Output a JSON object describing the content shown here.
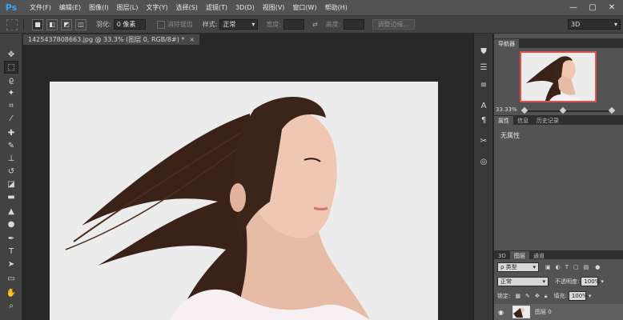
{
  "app": {
    "logo": "Ps"
  },
  "menu": [
    "文件(F)",
    "编辑(E)",
    "图像(I)",
    "图层(L)",
    "文字(Y)",
    "选择(S)",
    "滤镜(T)",
    "3D(D)",
    "视图(V)",
    "窗口(W)",
    "帮助(H)"
  ],
  "window_controls": {
    "minimize": "—",
    "maximize": "▢",
    "close": "✕"
  },
  "options": {
    "feather_label": "羽化:",
    "feather_value": "0 像素",
    "antialias_label": "消除锯齿",
    "style_label": "样式:",
    "style_value": "正常",
    "width_label": "宽度:",
    "height_label": "高度:",
    "refine_edge": "调整边缘...",
    "workspace": "3D"
  },
  "document": {
    "tab_title": "1425437808663.jpg @ 33.3% (图层 0, RGB/8#) *",
    "close": "×"
  },
  "navigator": {
    "tab": "导航器",
    "zoom": "33.33%"
  },
  "properties": {
    "tabs": [
      "属性",
      "信息",
      "历史记录"
    ],
    "empty_text": "无属性"
  },
  "layers": {
    "tabs": [
      "3D",
      "图层",
      "通道"
    ],
    "kind_label": "ρ 类型",
    "blend_mode": "正常",
    "opacity_label": "不透明度:",
    "opacity_value": "100%",
    "lock_label": "锁定:",
    "fill_label": "填充:",
    "fill_value": "100%",
    "layer_name": "图层 0"
  },
  "colors": {
    "menubar": "#535353",
    "panel": "#535353",
    "canvas_bg": "#282828",
    "accent_red": "#e05050"
  }
}
